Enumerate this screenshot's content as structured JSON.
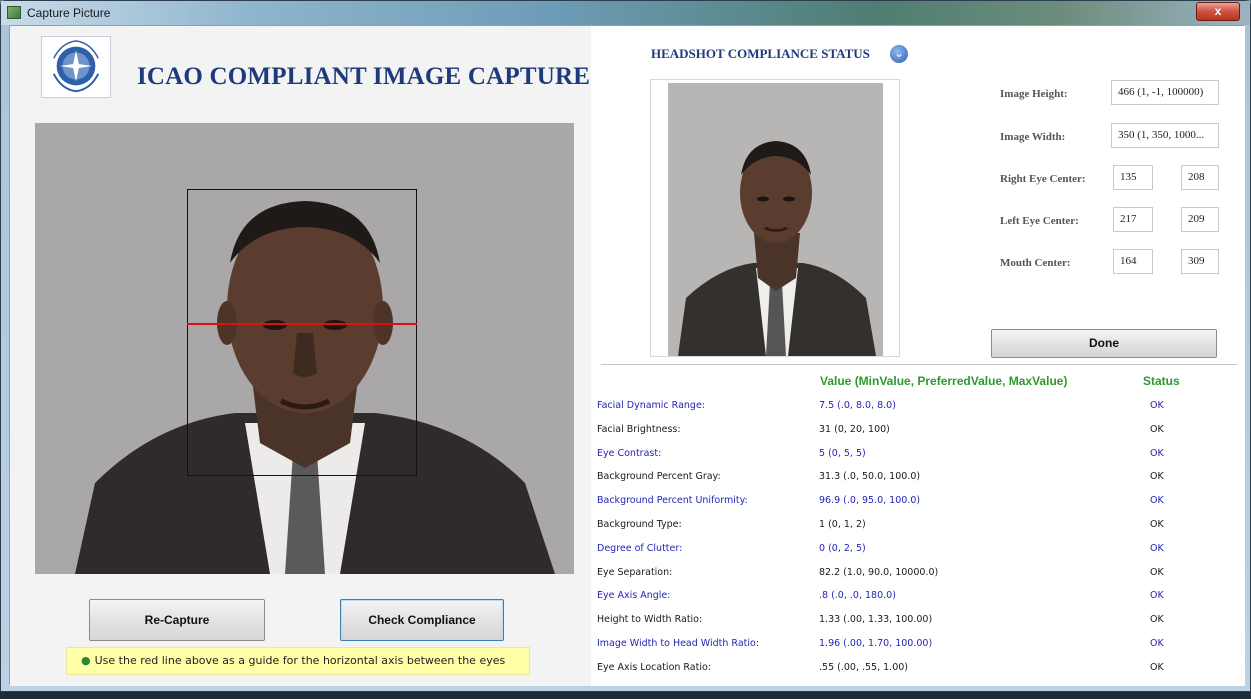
{
  "window": {
    "title": "Capture Picture",
    "close_glyph": "x"
  },
  "app": {
    "title": "ICAO COMPLIANT IMAGE CAPTURE",
    "logo": "icao-logo"
  },
  "capture": {
    "buttons": {
      "recapture": "Re-Capture",
      "check": "Check Compliance"
    },
    "hint": "Use the red line above as a guide for the horizontal axis between the eyes",
    "guide_line_color": "#e01010"
  },
  "status": {
    "title": "HEADSHOT COMPLIANCE STATUS",
    "info_icon": "chevron-down-icon",
    "fields": {
      "image_height_label": "Image Height:",
      "image_height_value": "466 (1, -1, 100000)",
      "image_width_label": "Image Width:",
      "image_width_value": "350 (1, 350, 1000...",
      "right_eye_label": "Right Eye Center:",
      "right_eye_x": "135",
      "right_eye_y": "208",
      "left_eye_label": "Left Eye Center:",
      "left_eye_x": "217",
      "left_eye_y": "209",
      "mouth_label": "Mouth Center:",
      "mouth_x": "164",
      "mouth_y": "309"
    },
    "done_label": "Done",
    "table": {
      "headers": {
        "value": "Value (MinValue, PreferredValue, MaxValue)",
        "status": "Status"
      },
      "rows": [
        {
          "name": "Facial Dynamic Range:",
          "value": "7.5 (.0, 8.0, 8.0)",
          "status": "OK"
        },
        {
          "name": "Facial Brightness:",
          "value": "31 (0, 20, 100)",
          "status": "OK"
        },
        {
          "name": "Eye Contrast:",
          "value": "5 (0, 5, 5)",
          "status": "OK"
        },
        {
          "name": "Background Percent Gray:",
          "value": "31.3 (.0, 50.0, 100.0)",
          "status": "OK"
        },
        {
          "name": "Background Percent Uniformity:",
          "value": "96.9 (.0, 95.0, 100.0)",
          "status": "OK"
        },
        {
          "name": "Background Type:",
          "value": "1 (0, 1, 2)",
          "status": "OK"
        },
        {
          "name": "Degree of Clutter:",
          "value": "0 (0, 2, 5)",
          "status": "OK"
        },
        {
          "name": "Eye Separation:",
          "value": "82.2 (1.0, 90.0, 10000.0)",
          "status": "OK"
        },
        {
          "name": "Eye Axis Angle:",
          "value": ".8 (.0, .0, 180.0)",
          "status": "OK"
        },
        {
          "name": "Height to Width Ratio:",
          "value": "1.33 (.00, 1.33, 100.00)",
          "status": "OK"
        },
        {
          "name": "Image Width to Head Width Ratio:",
          "value": "1.96 (.00, 1.70, 100.00)",
          "status": "OK"
        },
        {
          "name": "Eye Axis Location Ratio:",
          "value": ".55 (.00, .55, 1.00)",
          "status": "OK"
        }
      ]
    }
  }
}
